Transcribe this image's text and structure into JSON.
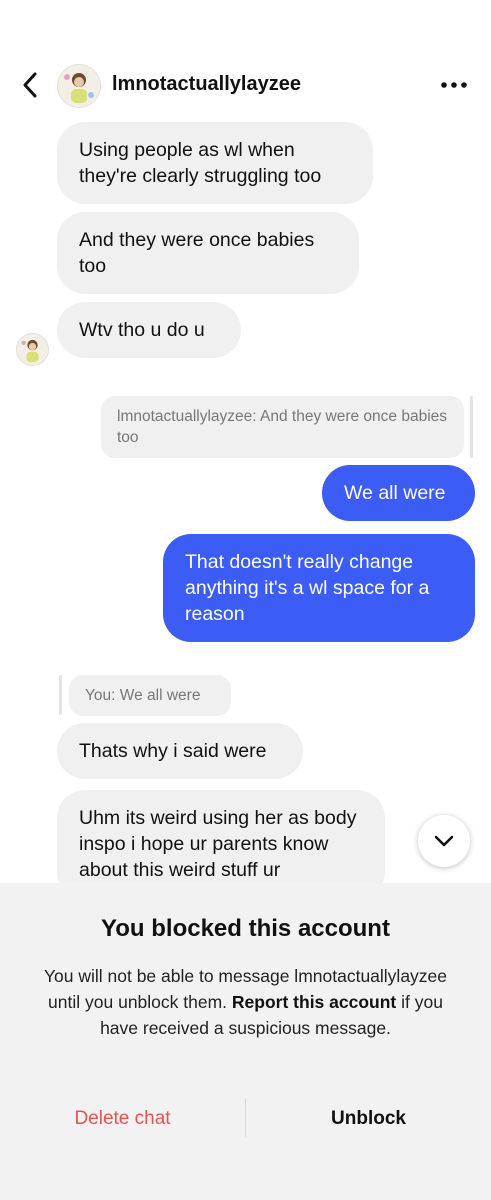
{
  "header": {
    "back_icon": "chevron-left-icon",
    "username": "lmnotactuallylayzee",
    "more_icon": "more-horizontal-icon"
  },
  "messages": [
    {
      "from": "them",
      "text": "Using people as wl when they're clearly struggling too"
    },
    {
      "from": "them",
      "text": "And they were once babies too"
    },
    {
      "from": "them",
      "text": "Wtv tho u do u"
    },
    {
      "from": "me",
      "quote": "lmnotactuallylayzee: And they were once babies too"
    },
    {
      "from": "me",
      "text": "We all were"
    },
    {
      "from": "me",
      "text": "That doesn't really change anything it's a wl space for a reason"
    },
    {
      "from": "them",
      "quote": "You: We all were"
    },
    {
      "from": "them",
      "text": "Thats why i said were"
    },
    {
      "from": "them",
      "text": "Uhm its weird using her as body inspo i hope ur parents know about this weird stuff ur"
    }
  ],
  "scroll_icon": "chevron-down-icon",
  "blocked_panel": {
    "title": "You blocked this account",
    "line1": "You will not be able to message lmnotactuallylayzee until you unblock them.",
    "report_link": "Report this account",
    "line2": " if you have received a suspicious message.",
    "delete_label": "Delete chat",
    "unblock_label": "Unblock"
  },
  "colors": {
    "outgoing_bubble": "#3b5cf5",
    "incoming_bubble": "#f0f0f0",
    "delete_red": "#e9534e",
    "panel_bg": "#f2f2f2"
  }
}
